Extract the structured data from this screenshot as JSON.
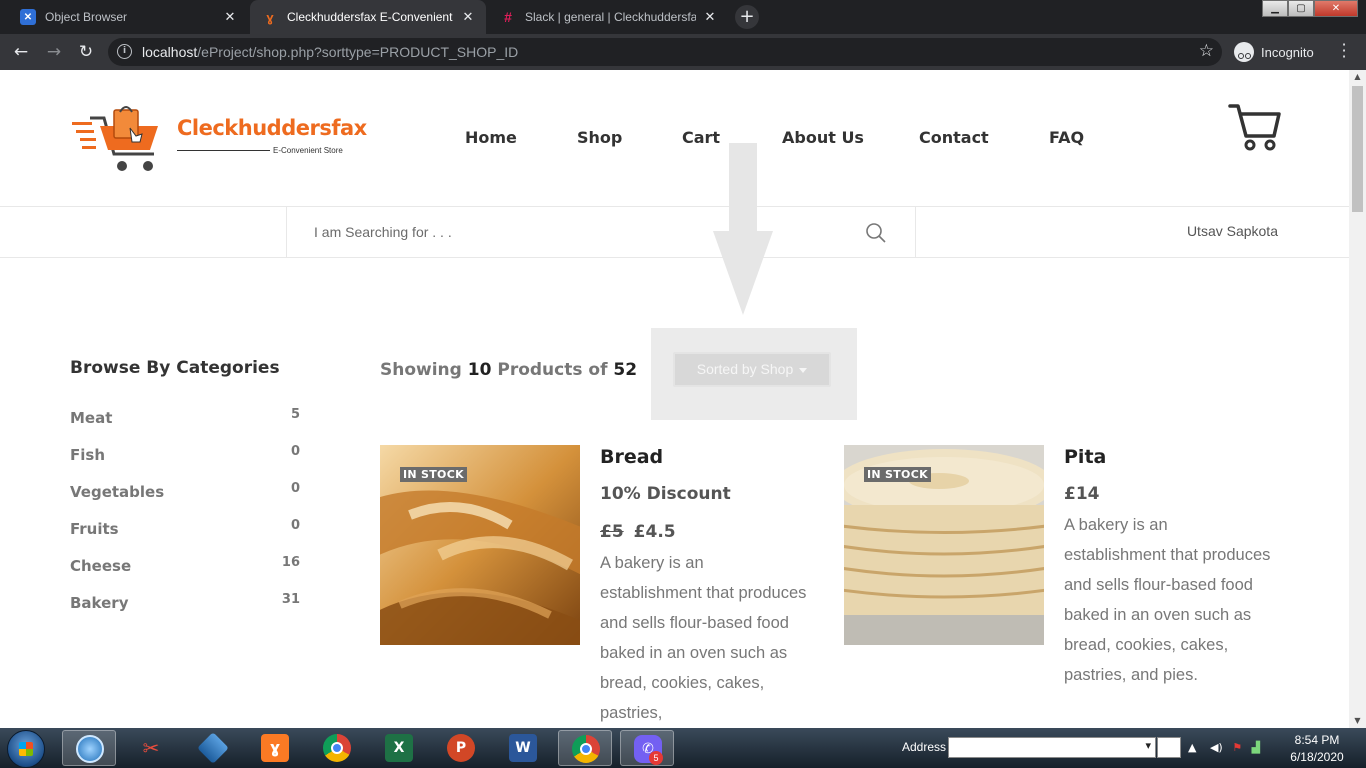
{
  "browser": {
    "tabs": [
      {
        "title": "Object Browser",
        "close": "✕"
      },
      {
        "title": "Cleckhuddersfax E-Convenient Store",
        "close": "✕"
      },
      {
        "title": "Slack | general | Cleckhuddersfax",
        "close": "✕"
      }
    ],
    "new_tab": "+",
    "url_host": "localhost",
    "url_path": "/eProject/shop.php?sorttype=PRODUCT_SHOP_ID",
    "profile_label": "Incognito"
  },
  "header": {
    "brand": "Cleckhuddersfax",
    "tagline": "E-Convenient Store",
    "nav": [
      "Home",
      "Shop",
      "Cart",
      "About Us",
      "Contact",
      "FAQ"
    ]
  },
  "search": {
    "placeholder": "I am Searching for . . .",
    "user_name": "Utsav Sapkota"
  },
  "sidebar": {
    "title": "Browse By Categories",
    "categories": [
      {
        "name": "Meat",
        "count": "5"
      },
      {
        "name": "Fish",
        "count": "0"
      },
      {
        "name": "Vegetables",
        "count": "0"
      },
      {
        "name": "Fruits",
        "count": "0"
      },
      {
        "name": "Cheese",
        "count": "16"
      },
      {
        "name": "Bakery",
        "count": "31"
      }
    ]
  },
  "listing": {
    "showing_prefix": "Showing",
    "showing_count": "10",
    "showing_middle": "Products of",
    "showing_total": "52",
    "sort_label": "Sorted by Shop"
  },
  "products": [
    {
      "name": "Bread",
      "badge": "IN STOCK",
      "discount": "10% Discount",
      "old_price": "£5",
      "price": "£4.5",
      "description": "A bakery is an establishment that produces and sells flour-based food baked in an oven such as bread, cookies, cakes, pastries,"
    },
    {
      "name": "Pita",
      "badge": "IN STOCK",
      "price": "£14",
      "description": "A bakery is an establishment that produces and sells flour-based food baked in an oven such as bread, cookies, cakes, pastries, and pies."
    }
  ],
  "taskbar": {
    "address_label": "Address",
    "time": "8:54 PM",
    "date": "6/18/2020",
    "viber_badge": "5"
  },
  "colors": {
    "brand_orange": "#ee6b1f",
    "chrome_dark": "#202124",
    "chrome_toolbar": "#35363a",
    "badge_gray": "#6b6b6b"
  }
}
